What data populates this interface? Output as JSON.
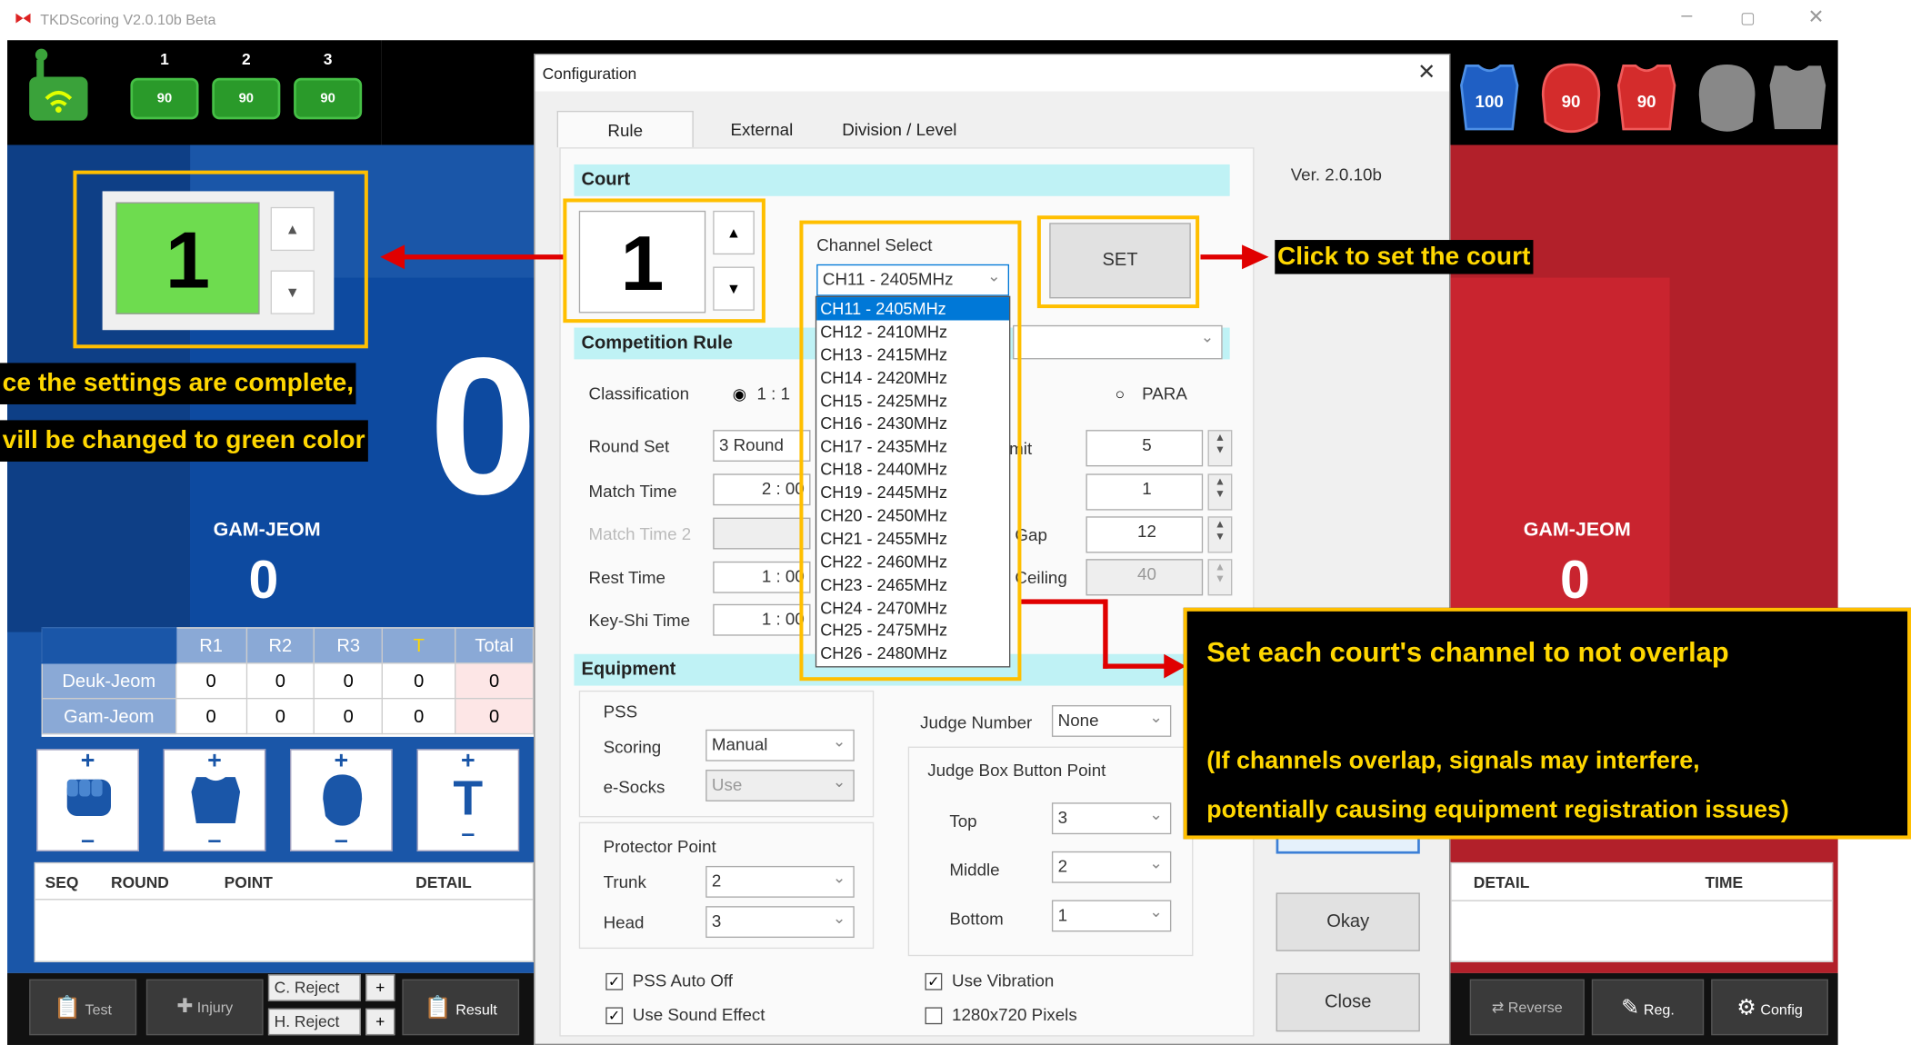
{
  "window": {
    "title": "TKDScoring V2.0.10b Beta",
    "minimize_icon": "minimize-icon",
    "maximize_icon": "maximize-icon",
    "close_icon": "close-icon"
  },
  "top_band": {
    "judges": [
      {
        "num": "1",
        "value": "90"
      },
      {
        "num": "2",
        "value": "90"
      },
      {
        "num": "3",
        "value": "90"
      }
    ],
    "right_badges": [
      "100",
      "90",
      "90"
    ]
  },
  "court_display": {
    "value": "1"
  },
  "blue": {
    "big_score": "0",
    "gamjeom_label": "GAM-JEOM",
    "gamjeom_value": "0",
    "table": {
      "headers": [
        "R1",
        "R2",
        "R3",
        "T",
        "Total"
      ],
      "rows": [
        {
          "label": "Deuk-Jeom",
          "values": [
            "0",
            "0",
            "0",
            "0",
            "0"
          ]
        },
        {
          "label": "Gam-Jeom",
          "values": [
            "0",
            "0",
            "0",
            "0",
            "0"
          ]
        }
      ]
    },
    "log_headers": [
      "SEQ",
      "ROUND",
      "POINT",
      "DETAIL"
    ],
    "bottom": {
      "test": "Test",
      "injury": "Injury",
      "c_reject": "C. Reject",
      "h_reject": "H. Reject",
      "plus": "+",
      "result": "Result"
    }
  },
  "red": {
    "gamjeom_label": "GAM-JEOM",
    "gamjeom_value": "0",
    "log_headers": [
      "DETAIL",
      "TIME"
    ],
    "bottom": {
      "reverse": "Reverse",
      "reg": "Reg.",
      "config": "Config"
    }
  },
  "dialog": {
    "title": "Configuration",
    "tabs": [
      "Rule",
      "External",
      "Division / Level"
    ],
    "version": "Ver. 2.0.10b",
    "court_section": "Court",
    "court_value": "1",
    "channel_select_label": "Channel Select",
    "channel_selected": "CH11 - 2405MHz",
    "channels": [
      "CH11 - 2405MHz",
      "CH12 - 2410MHz",
      "CH13 - 2415MHz",
      "CH14 - 2420MHz",
      "CH15 - 2425MHz",
      "CH16 - 2430MHz",
      "CH17 - 2435MHz",
      "CH18 - 2440MHz",
      "CH19 - 2445MHz",
      "CH20 - 2450MHz",
      "CH21 - 2455MHz",
      "CH22 - 2460MHz",
      "CH23 - 2465MHz",
      "CH24 - 2470MHz",
      "CH25 - 2475MHz",
      "CH26 - 2480MHz"
    ],
    "set_button": "SET",
    "competition_rule_section": "Competition Rule",
    "classification_label": "Classification",
    "classification_option1": "1 : 1",
    "classification_option_para": "PARA",
    "round_set_label": "Round Set",
    "round_set_value": "3 Round",
    "match_time_label": "Match Time",
    "match_time_value": "2 : 00",
    "match_time2_label": "Match Time 2",
    "rest_time_label": "Rest Time",
    "rest_time_value": "1 : 00",
    "keyshi_time_label": "Key-Shi Time",
    "keyshi_time_value": "1 : 00",
    "right_fields": [
      {
        "label": "imit",
        "value": "5"
      },
      {
        "label": "",
        "value": "1"
      },
      {
        "label": "t Gap",
        "value": "12"
      },
      {
        "label": "t Ceiling",
        "value": "40"
      }
    ],
    "equipment_section": "Equipment",
    "pss_label": "PSS",
    "scoring_label": "Scoring",
    "scoring_value": "Manual",
    "esocks_label": "e-Socks",
    "esocks_value": "Use",
    "protector_point_label": "Protector Point",
    "trunk_label": "Trunk",
    "trunk_value": "2",
    "head_label": "Head",
    "head_value": "3",
    "judge_number_label": "Judge Number",
    "judge_number_value": "None",
    "judge_box_label": "Judge Box Button Point",
    "top_label": "Top",
    "top_value": "3",
    "middle_label": "Middle",
    "middle_value": "2",
    "bottom_label": "Bottom",
    "bottom_value": "1",
    "pss_auto_off": "PSS Auto Off",
    "use_sound_effect": "Use Sound Effect",
    "use_vibration": "Use Vibration",
    "pixels_1280": "1280x720 Pixels",
    "okay_button": "Okay",
    "close_button": "Close"
  },
  "callouts": {
    "set_court": "Click to set the court",
    "settings_line1": "ce the settings are complete,",
    "settings_line2": "vill be changed to green color",
    "channel_note_title": "Set each court's channel to not overlap",
    "channel_note_line1": "(If channels overlap, signals may interfere,",
    "channel_note_line2": "potentially causing equipment registration issues)"
  },
  "colors": {
    "blue_side": "#1a56a8",
    "red_side": "#b2202a",
    "court_green": "#6edc4f",
    "callout_yellow": "#ffd700",
    "arrow_red": "#e00000",
    "selected_blue": "#0078d7"
  }
}
